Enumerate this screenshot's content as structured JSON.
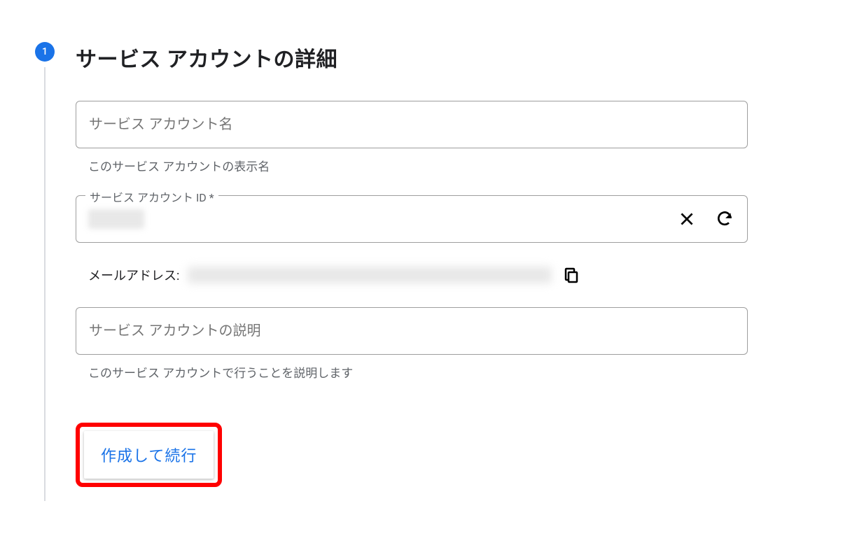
{
  "step": {
    "number": "1",
    "title": "サービス アカウントの詳細"
  },
  "fields": {
    "name": {
      "placeholder": "サービス アカウント名",
      "helper": "このサービス アカウントの表示名",
      "value": ""
    },
    "id": {
      "label": "サービス アカウント ID *",
      "value": "",
      "clear_icon": "close-icon",
      "refresh_icon": "refresh-icon"
    },
    "email": {
      "label": "メールアドレス:",
      "value": "",
      "copy_icon": "copy-icon"
    },
    "description": {
      "placeholder": "サービス アカウントの説明",
      "helper": "このサービス アカウントで行うことを説明します",
      "value": ""
    }
  },
  "buttons": {
    "create_and_continue": "作成して続行"
  },
  "colors": {
    "primary": "#1a73e8",
    "highlight": "#ff0000"
  }
}
